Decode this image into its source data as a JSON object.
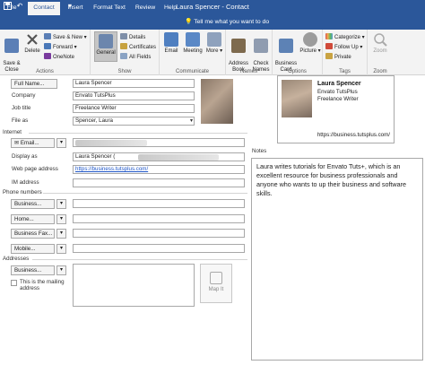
{
  "window": {
    "title": "Laura Spencer  -  Contact",
    "quick_access": [
      "save-icon",
      "undo-icon",
      "redo-icon",
      "up-arrow-icon",
      "down-arrow-icon",
      "dropdown-icon"
    ]
  },
  "tabs": [
    {
      "label": "File"
    },
    {
      "label": "Contact"
    },
    {
      "label": "Insert"
    },
    {
      "label": "Format Text"
    },
    {
      "label": "Review"
    },
    {
      "label": "Help"
    }
  ],
  "tell_me": "Tell me what you want to do",
  "ribbon": {
    "actions": {
      "label": "Actions",
      "save_close": "Save &\nClose",
      "delete": "Delete",
      "save_new": "Save & New",
      "forward": "Forward",
      "onenote": "OneNote"
    },
    "show": {
      "label": "Show",
      "general": "General",
      "details": "Details",
      "certificates": "Certificates",
      "all_fields": "All Fields"
    },
    "communicate": {
      "label": "Communicate",
      "email": "Email",
      "meeting": "Meeting",
      "more": "More"
    },
    "names": {
      "label": "Names",
      "address_book": "Address\nBook",
      "check_names": "Check\nNames"
    },
    "options": {
      "label": "Options",
      "business_card": "Business\nCard",
      "picture": "Picture"
    },
    "tags": {
      "label": "Tags",
      "categorize": "Categorize",
      "follow_up": "Follow Up",
      "private": "Private"
    },
    "zoom": {
      "label": "Zoom",
      "zoom": "Zoom"
    }
  },
  "form": {
    "full_name_btn": "Full Name...",
    "full_name": "Laura Spencer",
    "company_label": "Company",
    "company": "Envato TutsPlus",
    "job_title_label": "Job title",
    "job_title": "Freelance Writer",
    "file_as_label": "File as",
    "file_as": "Spencer, Laura",
    "internet_label": "Internet",
    "email_btn": "Email...",
    "display_as_label": "Display as",
    "display_as": "Laura Spencer (",
    "web_label": "Web page address",
    "web": "https://business.tutsplus.com/",
    "im_label": "IM address",
    "phone_label": "Phone numbers",
    "phone_business": "Business...",
    "phone_home": "Home...",
    "phone_fax": "Business Fax...",
    "phone_mobile": "Mobile...",
    "addresses_label": "Addresses",
    "address_btn": "Business...",
    "mailing_label": "This is the mailing\naddress",
    "map_it": "Map It",
    "notes_label": "Notes",
    "notes": "Laura writes tutorials for Envato Tuts+, which is an excellent resource for business professionals and anyone who wants to up their business and software skills."
  },
  "card": {
    "name": "Laura Spencer",
    "company": "Envato TutsPlus",
    "title": "Freelance Writer",
    "url": "https://business.tutsplus.com/"
  },
  "colors": {
    "ribbon_blue": "#2b579a",
    "link": "#1f56c8"
  }
}
